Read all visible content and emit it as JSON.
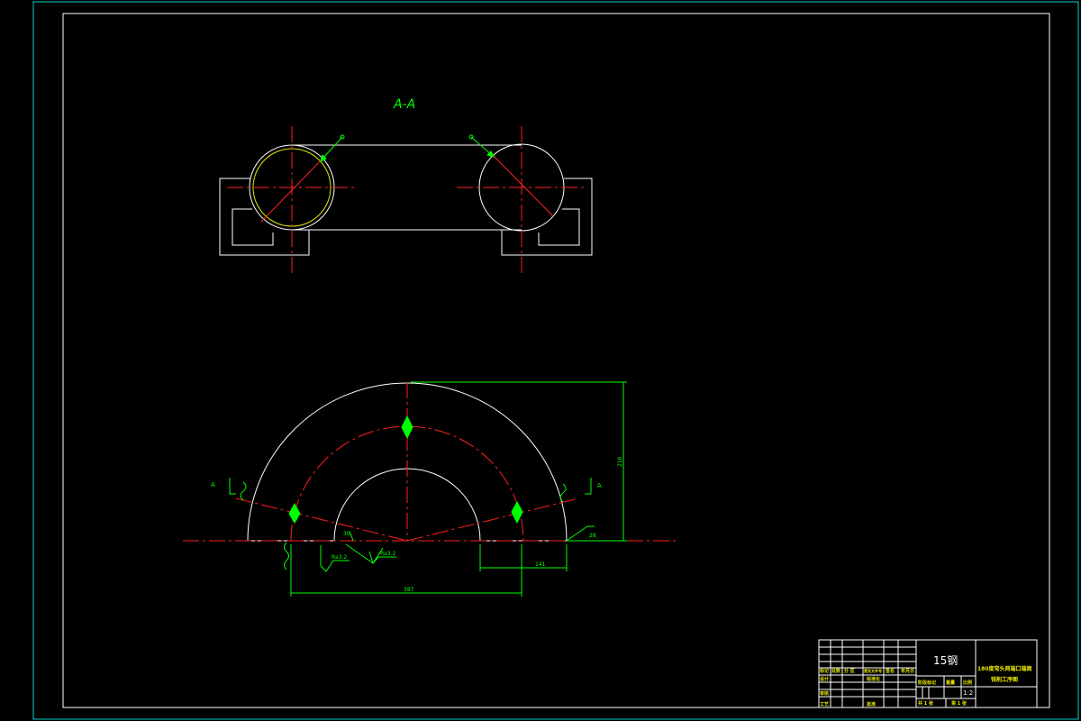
{
  "section_label": "A-A",
  "cut_marks": {
    "left": "A",
    "right": "A"
  },
  "dimensions": {
    "height": "216",
    "span": "387",
    "width_right": "141",
    "angle_left": "30",
    "chamfer_right": "28"
  },
  "surface_finish": {
    "left": "Ra3.2",
    "middle": "Ra3.2"
  },
  "title_block": {
    "material": "15钢",
    "drawing_name_line1": "180度弯头两端口端面",
    "drawing_name_line2": "铣削工序图",
    "header_labels": [
      "标记",
      "处数",
      "分 区",
      "更改文件号",
      "签名",
      "年月日"
    ],
    "role_labels": [
      "设计",
      "审核",
      "工艺"
    ],
    "standardize_label": "标准化",
    "approve_label": "批准",
    "stage_label": "阶段标记",
    "weight_label": "重量",
    "scale_label": "比例",
    "scale_value": "1:2",
    "sheets_total": "共 1 张",
    "sheet_current": "第 1 张"
  },
  "colors": {
    "background": "#000000",
    "sheet_border": "#00d0d0",
    "geometry": "#ffffff",
    "centerline": "#ff2020",
    "dimension": "#00ff00",
    "title_text": "#e8e800"
  }
}
